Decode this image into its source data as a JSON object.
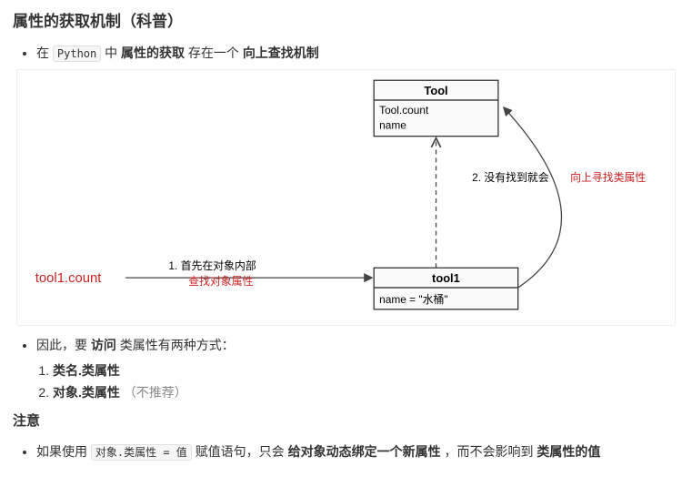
{
  "heading": "属性的获取机制（科普）",
  "intro": {
    "prefix": "在",
    "code": "Python",
    "mid": "中",
    "b1": "属性的获取",
    "mid2": "存在一个",
    "b2": "向上查找机制"
  },
  "diagram": {
    "tool_class": {
      "name": "Tool",
      "attr1": "Tool.count",
      "attr2": "name"
    },
    "tool1_obj": {
      "name": "tool1",
      "attr1": "name = \"水桶\""
    },
    "left_label": "tool1.count",
    "step1_a": "1. 首先在对象内部",
    "step1_b": "查找对象属性",
    "step2_a": "2. 没有找到就会",
    "step2_b": "向上寻找类属性"
  },
  "therefore": {
    "prefix": "因此，要",
    "b": "访问",
    "suffix": "类属性有两种方式："
  },
  "ways": {
    "w1": "类名.类属性",
    "w2_bold": "对象.类属性",
    "w2_gray": "（不推荐）"
  },
  "note_heading": "注意",
  "note": {
    "prefix": "如果使用",
    "code": "对象.类属性 = 值",
    "mid": "赋值语句，只会",
    "b1": "给对象动态绑定一个新属性",
    "mid2": "，而不会影响到",
    "b2": "类属性的值"
  }
}
